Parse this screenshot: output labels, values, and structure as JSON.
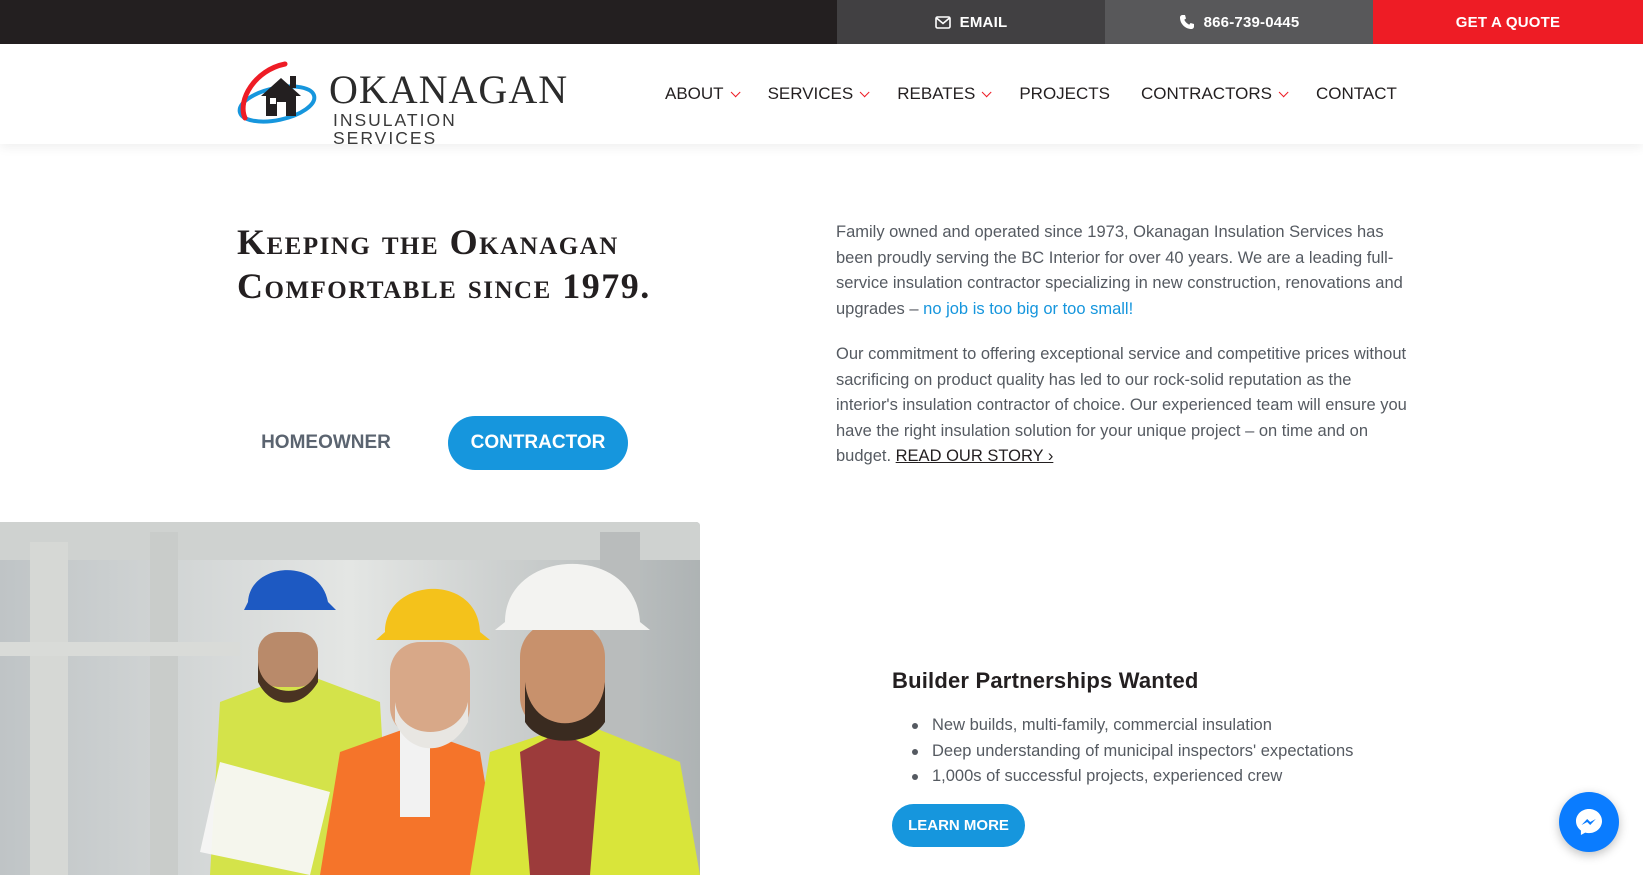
{
  "topbar": {
    "email_label": "EMAIL",
    "phone_label": "866-739-0445",
    "quote_label": "GET A QUOTE"
  },
  "logo": {
    "title": "OKANAGAN",
    "subtitle": "INSULATION SERVICES"
  },
  "nav": {
    "items": [
      {
        "label": "ABOUT",
        "dropdown": true
      },
      {
        "label": "SERVICES",
        "dropdown": true
      },
      {
        "label": "REBATES",
        "dropdown": true
      },
      {
        "label": "PROJECTS",
        "dropdown": false
      },
      {
        "label": "CONTRACTORS",
        "dropdown": true
      },
      {
        "label": "CONTACT",
        "dropdown": false
      }
    ]
  },
  "intro": {
    "headline_line1": "Keeping the Okanagan",
    "headline_line2": "Comfortable since 1979.",
    "toggle_homeowner": "HOMEOWNER",
    "toggle_contractor": "CONTRACTOR",
    "p1_text": "Family owned and operated since 1973, Okanagan Insulation Services has been proudly serving the BC Interior for over 40 years. We are a leading full-service insulation contractor specializing in new construction, renovations and upgrades – ",
    "p1_highlight": "no job is too big or too small!",
    "p2_text": "Our commitment to offering exceptional service and competitive prices without sacrificing on product quality has led to our rock-solid reputation as the interior's insulation contractor of choice. Our experienced team will ensure you have the right insulation solution for your unique project – on time and on budget. ",
    "story_link": "READ OUR STORY ›"
  },
  "builder": {
    "title": "Builder Partnerships Wanted",
    "bullets": [
      "New builds, multi-family, commercial insulation",
      "Deep understanding of municipal inspectors' expectations",
      "1,000s of successful projects, experienced crew"
    ],
    "learn_more": "LEARN MORE"
  },
  "icons": {
    "email": "envelope-icon",
    "phone": "phone-icon",
    "messenger": "messenger-icon"
  },
  "colors": {
    "brand_red": "#ee1c25",
    "brand_blue": "#1696dd",
    "topbar_dark": "#231f20"
  }
}
